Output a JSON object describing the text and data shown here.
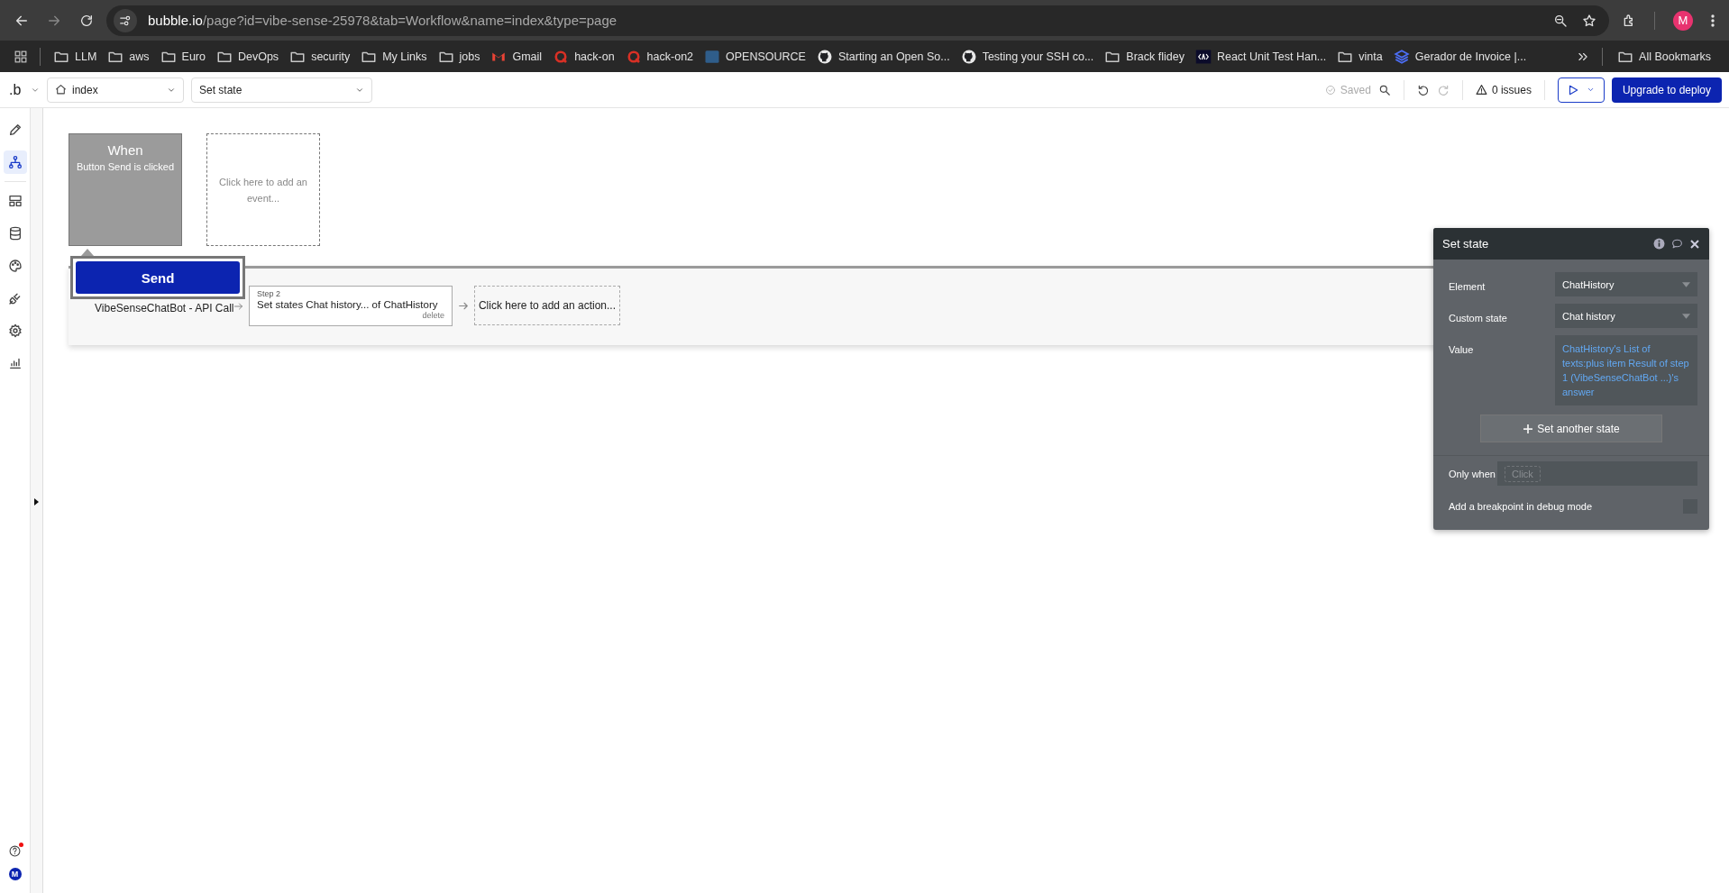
{
  "browser": {
    "url_host": "bubble.io",
    "url_path": "/page?id=vibe-sense-25978&tab=Workflow&name=index&type=page",
    "profile_initial": "M",
    "bookmarks": [
      {
        "label": "LLM",
        "kind": "folder"
      },
      {
        "label": "aws",
        "kind": "folder"
      },
      {
        "label": "Euro",
        "kind": "folder"
      },
      {
        "label": "DevOps",
        "kind": "folder"
      },
      {
        "label": "security",
        "kind": "folder"
      },
      {
        "label": "My Links",
        "kind": "folder"
      },
      {
        "label": "jobs",
        "kind": "folder"
      },
      {
        "label": "Gmail",
        "kind": "mail"
      },
      {
        "label": "hack-on",
        "kind": "ring"
      },
      {
        "label": "hack-on2",
        "kind": "ring"
      },
      {
        "label": "OPENSOURCE",
        "kind": "square"
      },
      {
        "label": "Starting an Open So...",
        "kind": "github"
      },
      {
        "label": "Testing your SSH co...",
        "kind": "github"
      },
      {
        "label": "Brack flidey",
        "kind": "folder"
      },
      {
        "label": "React Unit Test Han...",
        "kind": "code"
      },
      {
        "label": "vinta",
        "kind": "folder"
      },
      {
        "label": "Gerador de Invoice |...",
        "kind": "stack"
      }
    ],
    "all_bookmarks": "All Bookmarks"
  },
  "toolbar": {
    "logo": ".b",
    "page": "index",
    "action": "Set state",
    "saved": "Saved",
    "issues": "0 issues",
    "deploy": "Upgrade to deploy"
  },
  "sidebar": {
    "items": [
      {
        "kind": "pencil",
        "selected": false
      },
      {
        "kind": "workflow",
        "selected": true
      },
      {
        "kind": "layout",
        "selected": false
      },
      {
        "kind": "database",
        "selected": false
      },
      {
        "kind": "palette",
        "selected": false
      },
      {
        "kind": "plug",
        "selected": false
      },
      {
        "kind": "gear",
        "selected": false
      },
      {
        "kind": "chart",
        "selected": false
      }
    ],
    "help_notification": true,
    "avatar": "M"
  },
  "workflow": {
    "event": {
      "title": "When",
      "subtitle": "Button Send is clicked"
    },
    "add_event": "Click here to add an event...",
    "step1": "VibeSenseChatBot - API Call",
    "step2": {
      "label": "Step 2",
      "title": "Set states Chat history... of ChatHistory",
      "action": "delete"
    },
    "add_action": "Click here to add an action...",
    "overlay_button": "Send"
  },
  "panel": {
    "title": "Set state",
    "fields": [
      {
        "label": "Element",
        "value": "ChatHistory",
        "kind": "dropdown"
      },
      {
        "label": "Custom state",
        "value": "Chat history",
        "kind": "dropdown"
      },
      {
        "label": "Value",
        "value": "ChatHistory's List of texts:plus item Result of step 1 (VibeSenseChatBot ...)'s answer",
        "kind": "expression"
      }
    ],
    "add_button": "Set another state",
    "only_when": {
      "label": "Only when",
      "placeholder": "Click"
    },
    "breakpoint": {
      "label": "Add a breakpoint in debug mode",
      "checked": false
    }
  }
}
